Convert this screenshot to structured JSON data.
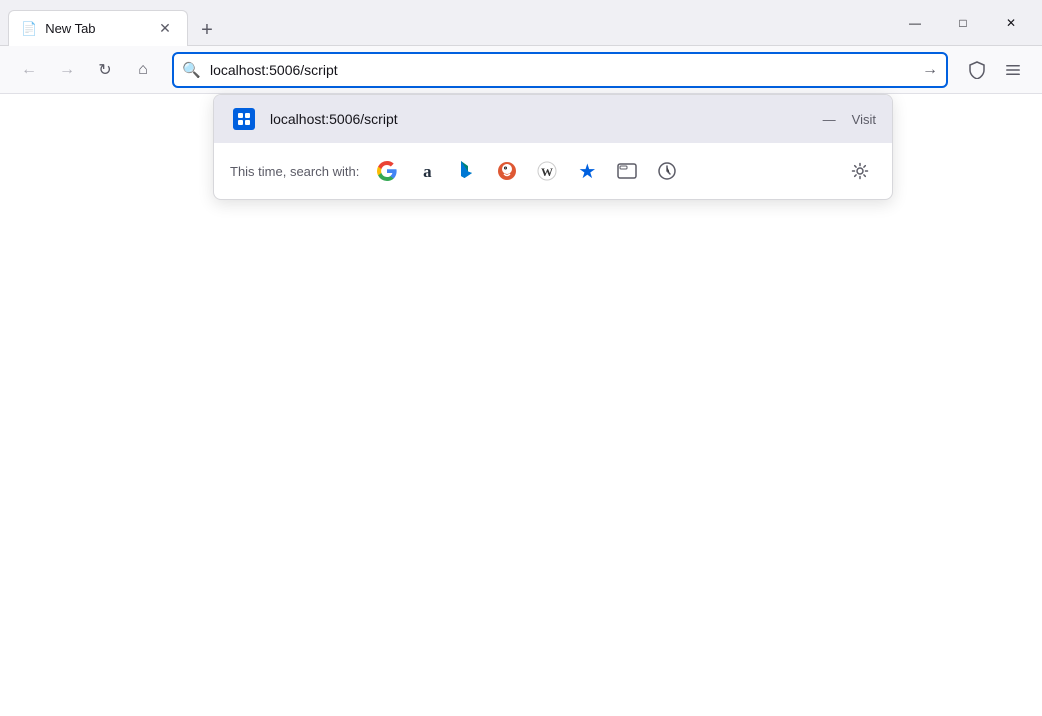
{
  "titleBar": {
    "tab": {
      "title": "New Tab",
      "favicon": "📄"
    },
    "newTabLabel": "+",
    "windowControls": {
      "minimize": "—",
      "maximize": "□",
      "close": "✕"
    }
  },
  "toolbar": {
    "backLabel": "←",
    "forwardLabel": "→",
    "reloadLabel": "↻",
    "homeLabel": "⌂",
    "addressValue": "localhost:5006/script",
    "goLabel": "→",
    "bookmarksLabel": "♡",
    "menuLabel": "≡"
  },
  "dropdown": {
    "suggestion": {
      "url": "localhost:5006/script",
      "dash": "—",
      "action": "Visit"
    },
    "searchWith": {
      "label": "This time, search with:",
      "engines": [
        {
          "name": "google",
          "label": "G"
        },
        {
          "name": "amazon",
          "label": "a"
        },
        {
          "name": "bing",
          "label": "b"
        },
        {
          "name": "duckduckgo",
          "label": "🦆"
        },
        {
          "name": "wikipedia",
          "label": "W"
        },
        {
          "name": "bookmarks",
          "label": "★"
        },
        {
          "name": "tabs",
          "label": "⬜"
        },
        {
          "name": "history",
          "label": "🕐"
        }
      ],
      "settingsLabel": "⚙"
    }
  },
  "page": {
    "background": "#ffffff"
  }
}
